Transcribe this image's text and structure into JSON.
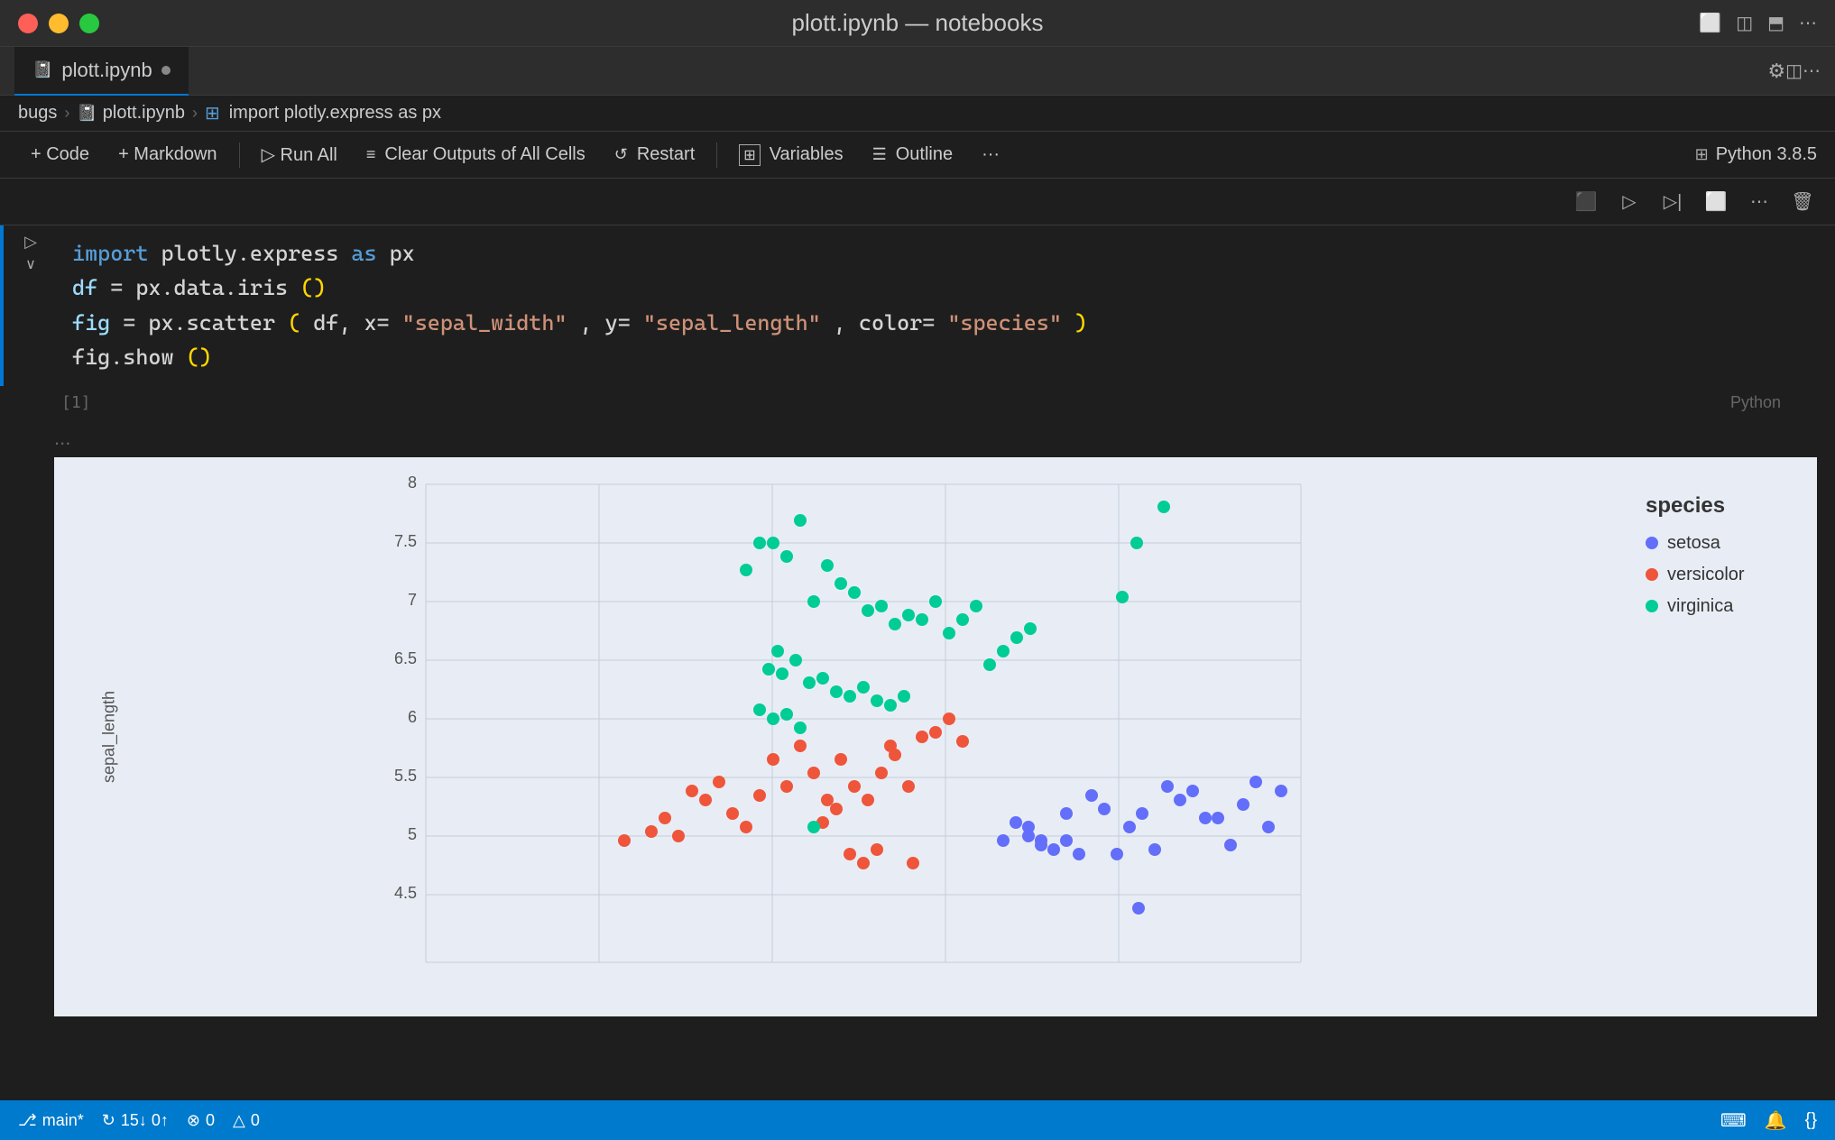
{
  "titlebar": {
    "title": "plott.ipynb — notebooks",
    "icon_layout": "□",
    "icon_split_h": "⊟",
    "icon_split_v": "⊞",
    "icon_more": "⋯"
  },
  "tabs": [
    {
      "label": "plott.ipynb",
      "active": true,
      "modified": true
    }
  ],
  "breadcrumb": {
    "items": [
      "bugs",
      "plott.ipynb",
      "import plotly.express as px"
    ]
  },
  "toolbar": {
    "code_label": "+ Code",
    "markdown_label": "+ Markdown",
    "run_all_label": "▷ Run All",
    "clear_outputs_label": "Clear Outputs of All Cells",
    "restart_label": "Restart",
    "variables_label": "Variables",
    "outline_label": "Outline",
    "more_label": "···",
    "python_label": "Python 3.8.5"
  },
  "cell": {
    "number": "[1]",
    "language": "Python",
    "code_lines": [
      {
        "parts": [
          {
            "text": "import",
            "cls": "code-kw"
          },
          {
            "text": " plotly.express ",
            "cls": "code-default"
          },
          {
            "text": "as",
            "cls": "code-kw"
          },
          {
            "text": " px",
            "cls": "code-default"
          }
        ]
      },
      {
        "parts": [
          {
            "text": "df",
            "cls": "code-var"
          },
          {
            "text": " = px.data.iris",
            "cls": "code-default"
          },
          {
            "text": "()",
            "cls": "code-paren"
          }
        ]
      },
      {
        "parts": [
          {
            "text": "fig",
            "cls": "code-var"
          },
          {
            "text": " = px.scatter",
            "cls": "code-default"
          },
          {
            "text": "(",
            "cls": "code-paren"
          },
          {
            "text": "df",
            "cls": "code-default"
          },
          {
            "text": ", x=",
            "cls": "code-default"
          },
          {
            "text": "\"sepal_width\"",
            "cls": "code-str"
          },
          {
            "text": ", y=",
            "cls": "code-default"
          },
          {
            "text": "\"sepal_length\"",
            "cls": "code-str"
          },
          {
            "text": ", color=",
            "cls": "code-default"
          },
          {
            "text": "\"species\"",
            "cls": "code-str"
          },
          {
            "text": ")",
            "cls": "code-paren"
          }
        ]
      },
      {
        "parts": [
          {
            "text": "fig.show",
            "cls": "code-default"
          },
          {
            "text": "()",
            "cls": "code-paren"
          }
        ]
      }
    ]
  },
  "output": {
    "dots": "..."
  },
  "chart": {
    "y_label": "sepal_length",
    "y_ticks": [
      "4.5",
      "5",
      "5.5",
      "6",
      "6.5",
      "7",
      "7.5",
      "8"
    ],
    "legend": {
      "title": "species",
      "items": [
        {
          "label": "setosa",
          "color": "#636efa"
        },
        {
          "label": "versicolor",
          "color": "#ef553b"
        },
        {
          "label": "virginica",
          "color": "#00cc96"
        }
      ]
    }
  },
  "statusbar": {
    "branch": "main*↓",
    "sync": "↻ 15↓ 0↑",
    "errors": "⊗ 0",
    "warnings": "△ 0"
  },
  "icons": {
    "run": "▷",
    "collapse": "∨",
    "notebook": "📓",
    "branch": "⎇",
    "bell": "🔔",
    "curly": "{}"
  }
}
